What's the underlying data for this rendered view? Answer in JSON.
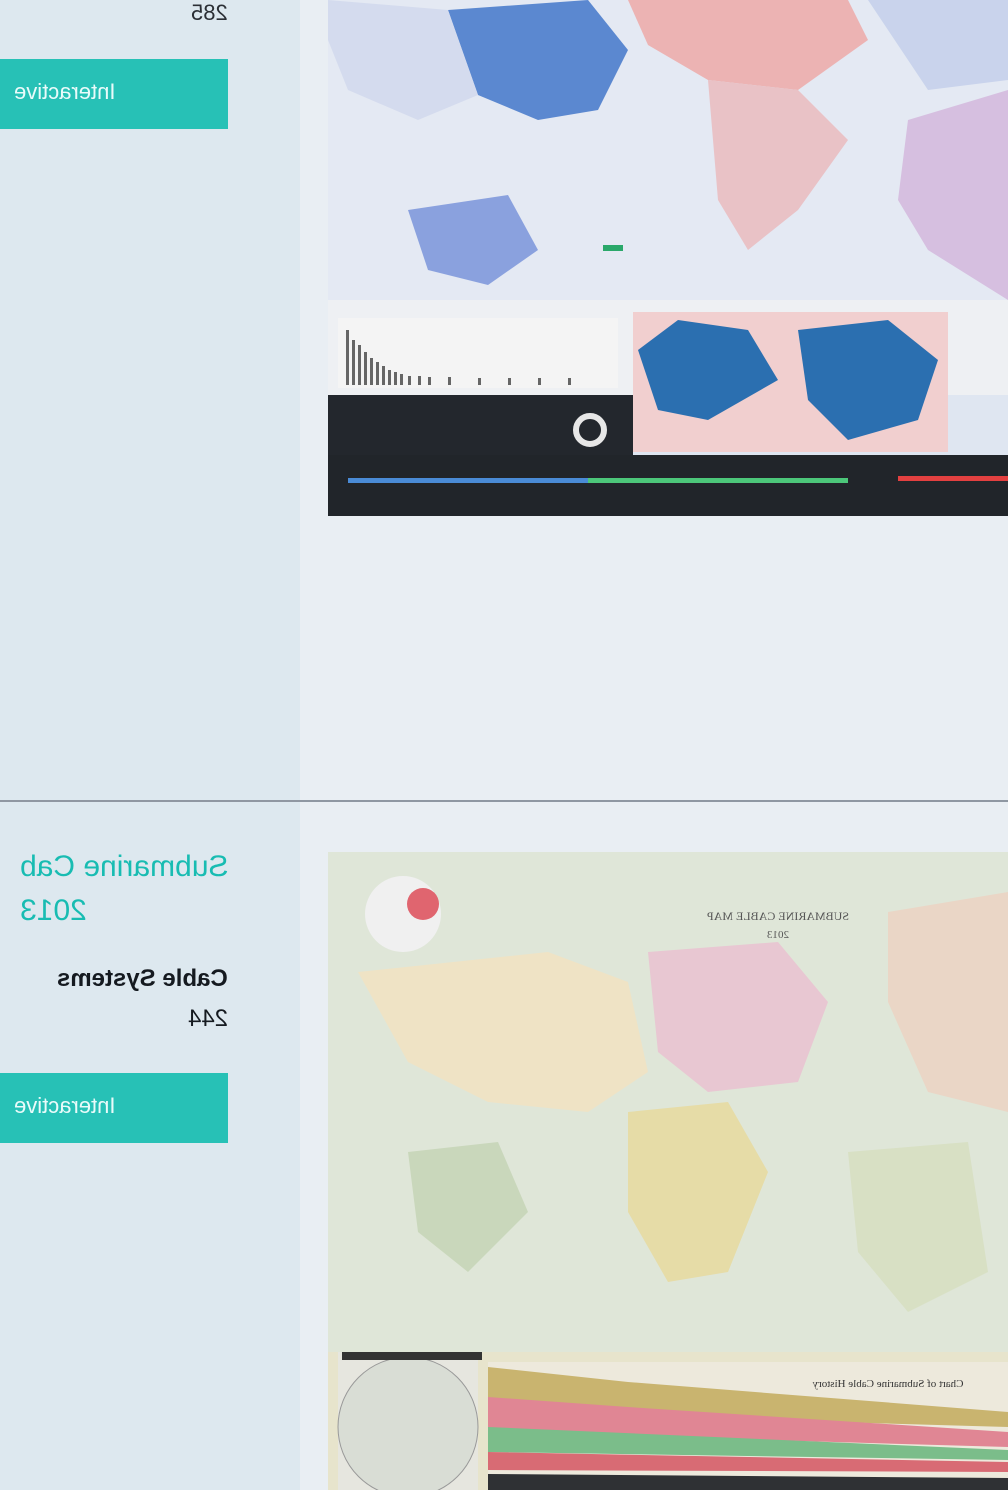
{
  "top_item": {
    "count_value": "285",
    "button_label": "Interactive"
  },
  "second_item": {
    "title_lines": [
      "Submarine Cab",
      "2013"
    ],
    "cable_systems_label": "Cable Systems",
    "cable_systems_value": "244",
    "button_label": "Interactive"
  },
  "map2_labels": {
    "map_title": "SUBMARINE CABLE MAP",
    "map_year": "2013",
    "chart_caption": "Chart of Submarine Cable History"
  },
  "colors": {
    "accent": "#27c1b6",
    "title_color": "#18bcb2",
    "divider": "#8f97a2"
  }
}
